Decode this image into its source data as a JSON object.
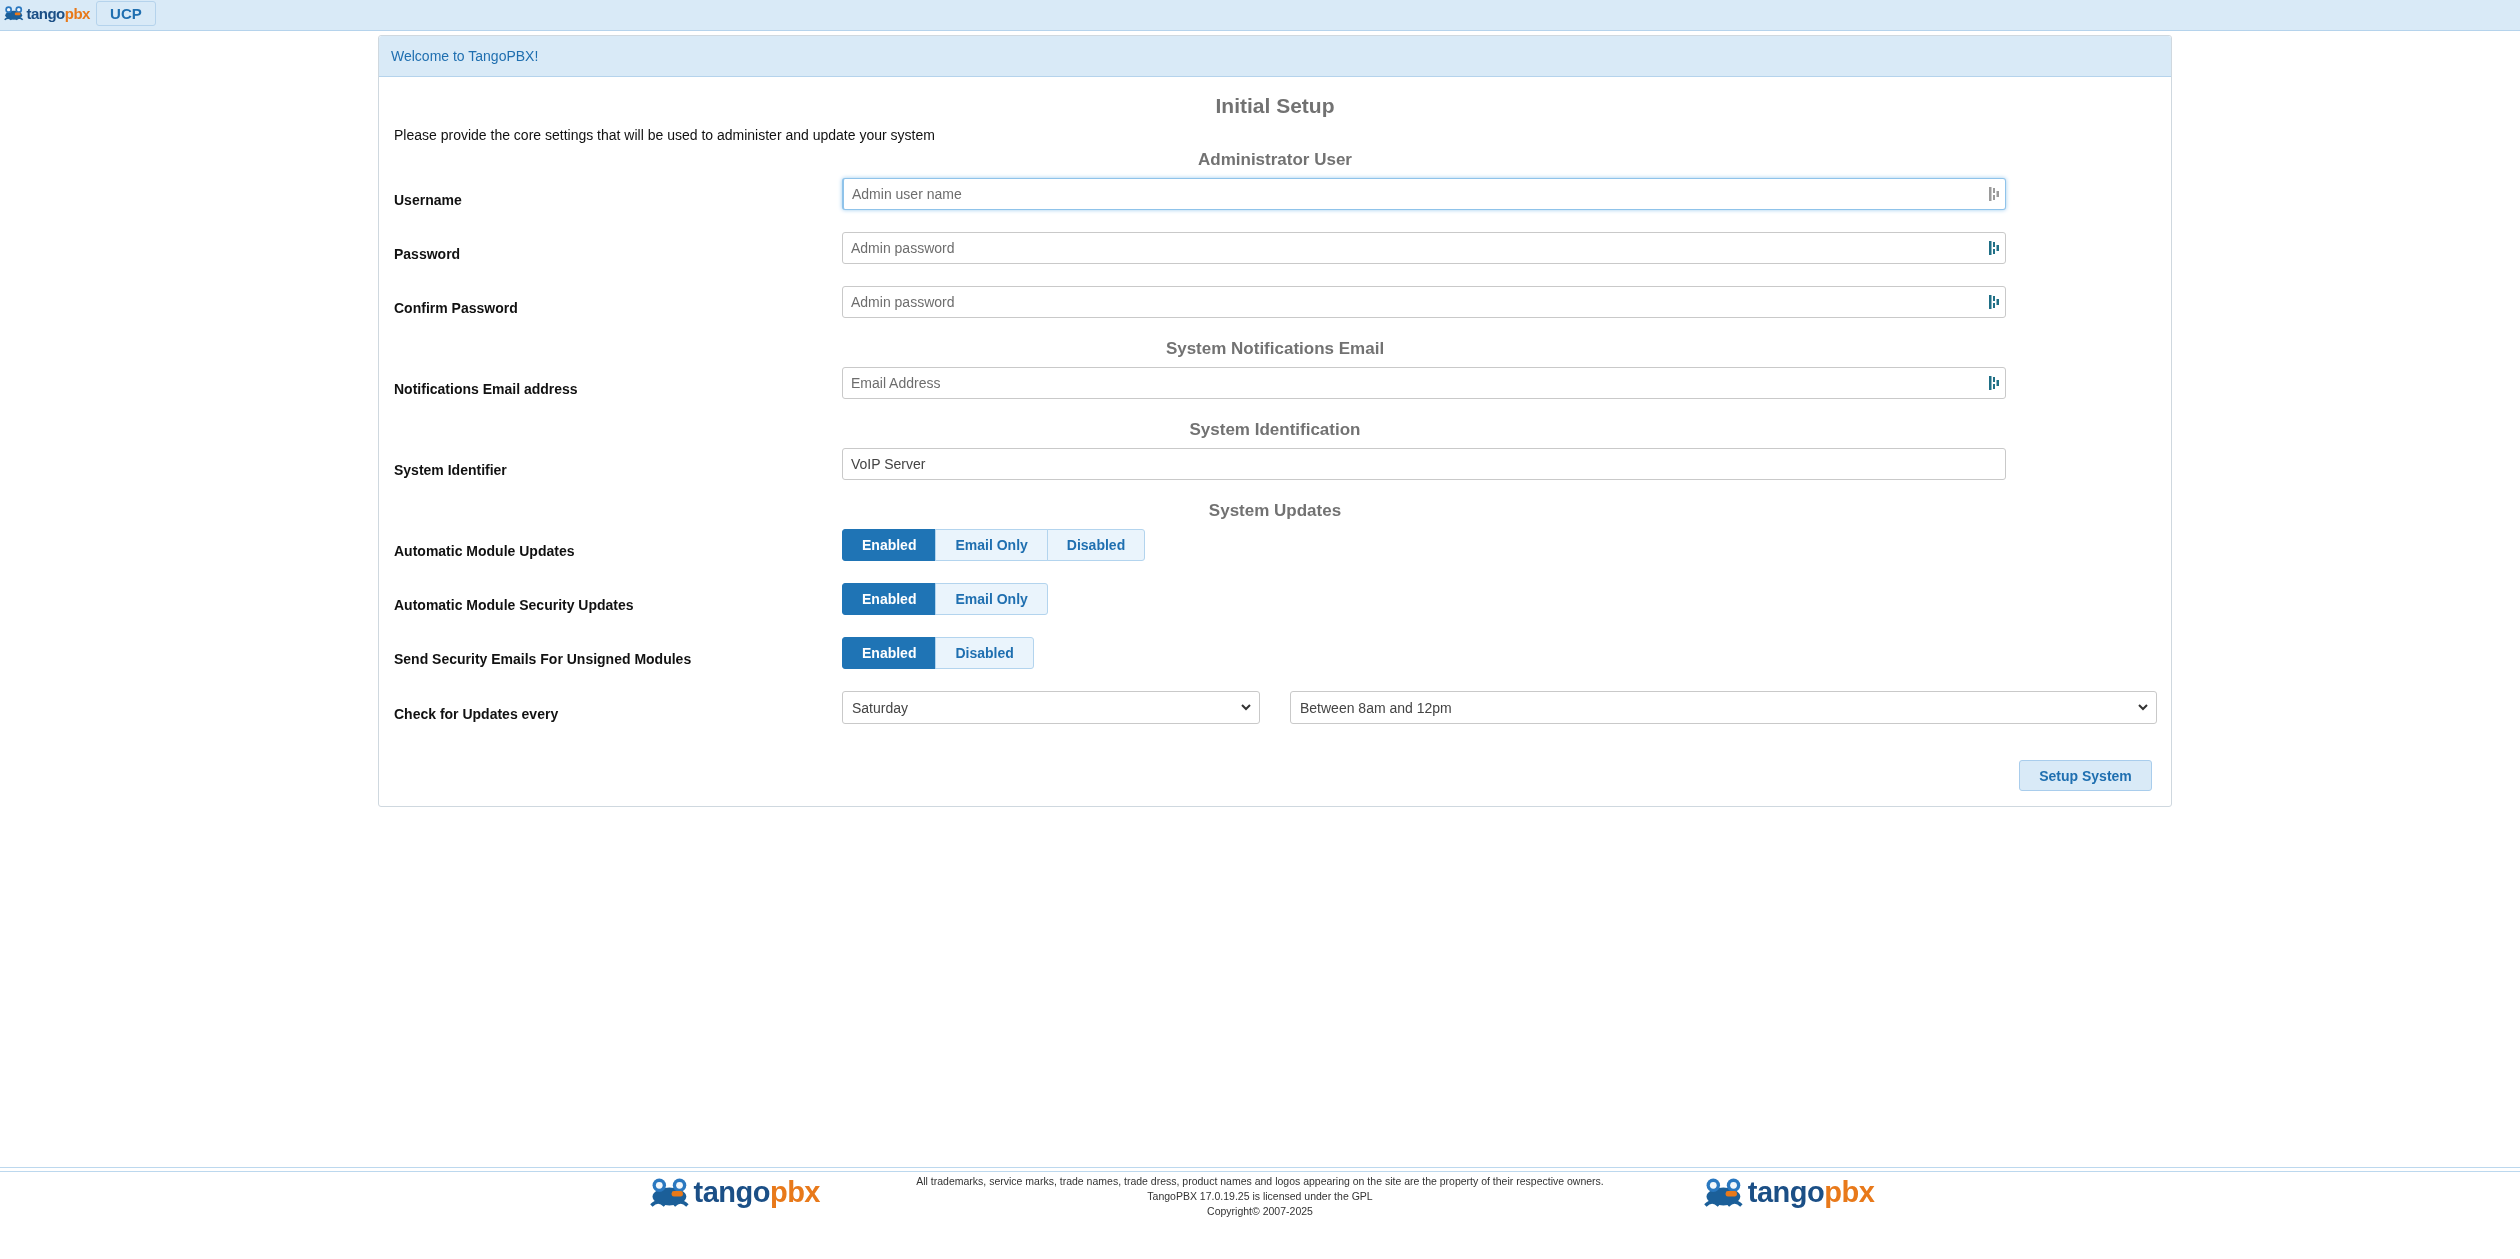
{
  "top_bar": {
    "logo": {
      "part_1": "tango",
      "part_2": "pbx"
    },
    "tabs": [
      {
        "label": "UCP",
        "selected": false
      }
    ]
  },
  "panel": {
    "heading": "Welcome to TangoPBX!",
    "title": "Initial Setup",
    "description": "Please provide the core settings that will be used to administer and update your system",
    "sections": [
      {
        "heading": "Administrator User",
        "rows": [
          {
            "kind": "text",
            "label": "Username",
            "placeholder": "Admin user name",
            "focused": true,
            "manager_icon": true
          },
          {
            "kind": "text",
            "label": "Password",
            "placeholder": "Admin password",
            "focused": false,
            "manager_icon": true
          },
          {
            "kind": "text",
            "label": "Confirm Password",
            "placeholder": "Admin password",
            "focused": false,
            "manager_icon": true
          }
        ]
      },
      {
        "heading": "System Notifications Email",
        "rows": [
          {
            "kind": "text",
            "label": "Notifications Email address",
            "placeholder": "Email Address",
            "focused": false,
            "manager_icon": true
          }
        ]
      },
      {
        "heading": "System Identification",
        "rows": [
          {
            "kind": "text",
            "label": "System Identifier",
            "value": "VoIP Server",
            "focused": false,
            "manager_icon": false
          }
        ]
      },
      {
        "heading": "System Updates",
        "rows": [
          {
            "kind": "toggle",
            "label": "Automatic Module Updates",
            "options": [
              {
                "label": "Enabled",
                "selected": true
              },
              {
                "label": "Email Only",
                "selected": false
              },
              {
                "label": "Disabled",
                "selected": false
              }
            ]
          },
          {
            "kind": "toggle",
            "label": "Automatic Module Security Updates",
            "options": [
              {
                "label": "Enabled",
                "selected": true
              },
              {
                "label": "Email Only",
                "selected": false
              }
            ]
          },
          {
            "kind": "toggle",
            "label": "Send Security Emails For Unsigned Modules",
            "options": [
              {
                "label": "Enabled",
                "selected": true
              },
              {
                "label": "Disabled",
                "selected": false
              }
            ]
          },
          {
            "kind": "select",
            "label": "Check for Updates every",
            "selects": [
              {
                "value": "Saturday"
              },
              {
                "value": "Between 8am and 12pm"
              }
            ]
          }
        ]
      }
    ],
    "button": "Setup System"
  },
  "footer": {
    "logos": [
      {
        "part_1": "tango",
        "part_2": "pbx"
      },
      {
        "part_1": "tango",
        "part_2": "pbx"
      }
    ],
    "lines": [
      "All trademarks, service marks, trade names, trade dress, product names and logos appearing on the site are the property of their respective owners.",
      "TangoPBX 17.0.19.25 is licensed under the GPL",
      "Copyright© 2007-2025"
    ]
  }
}
